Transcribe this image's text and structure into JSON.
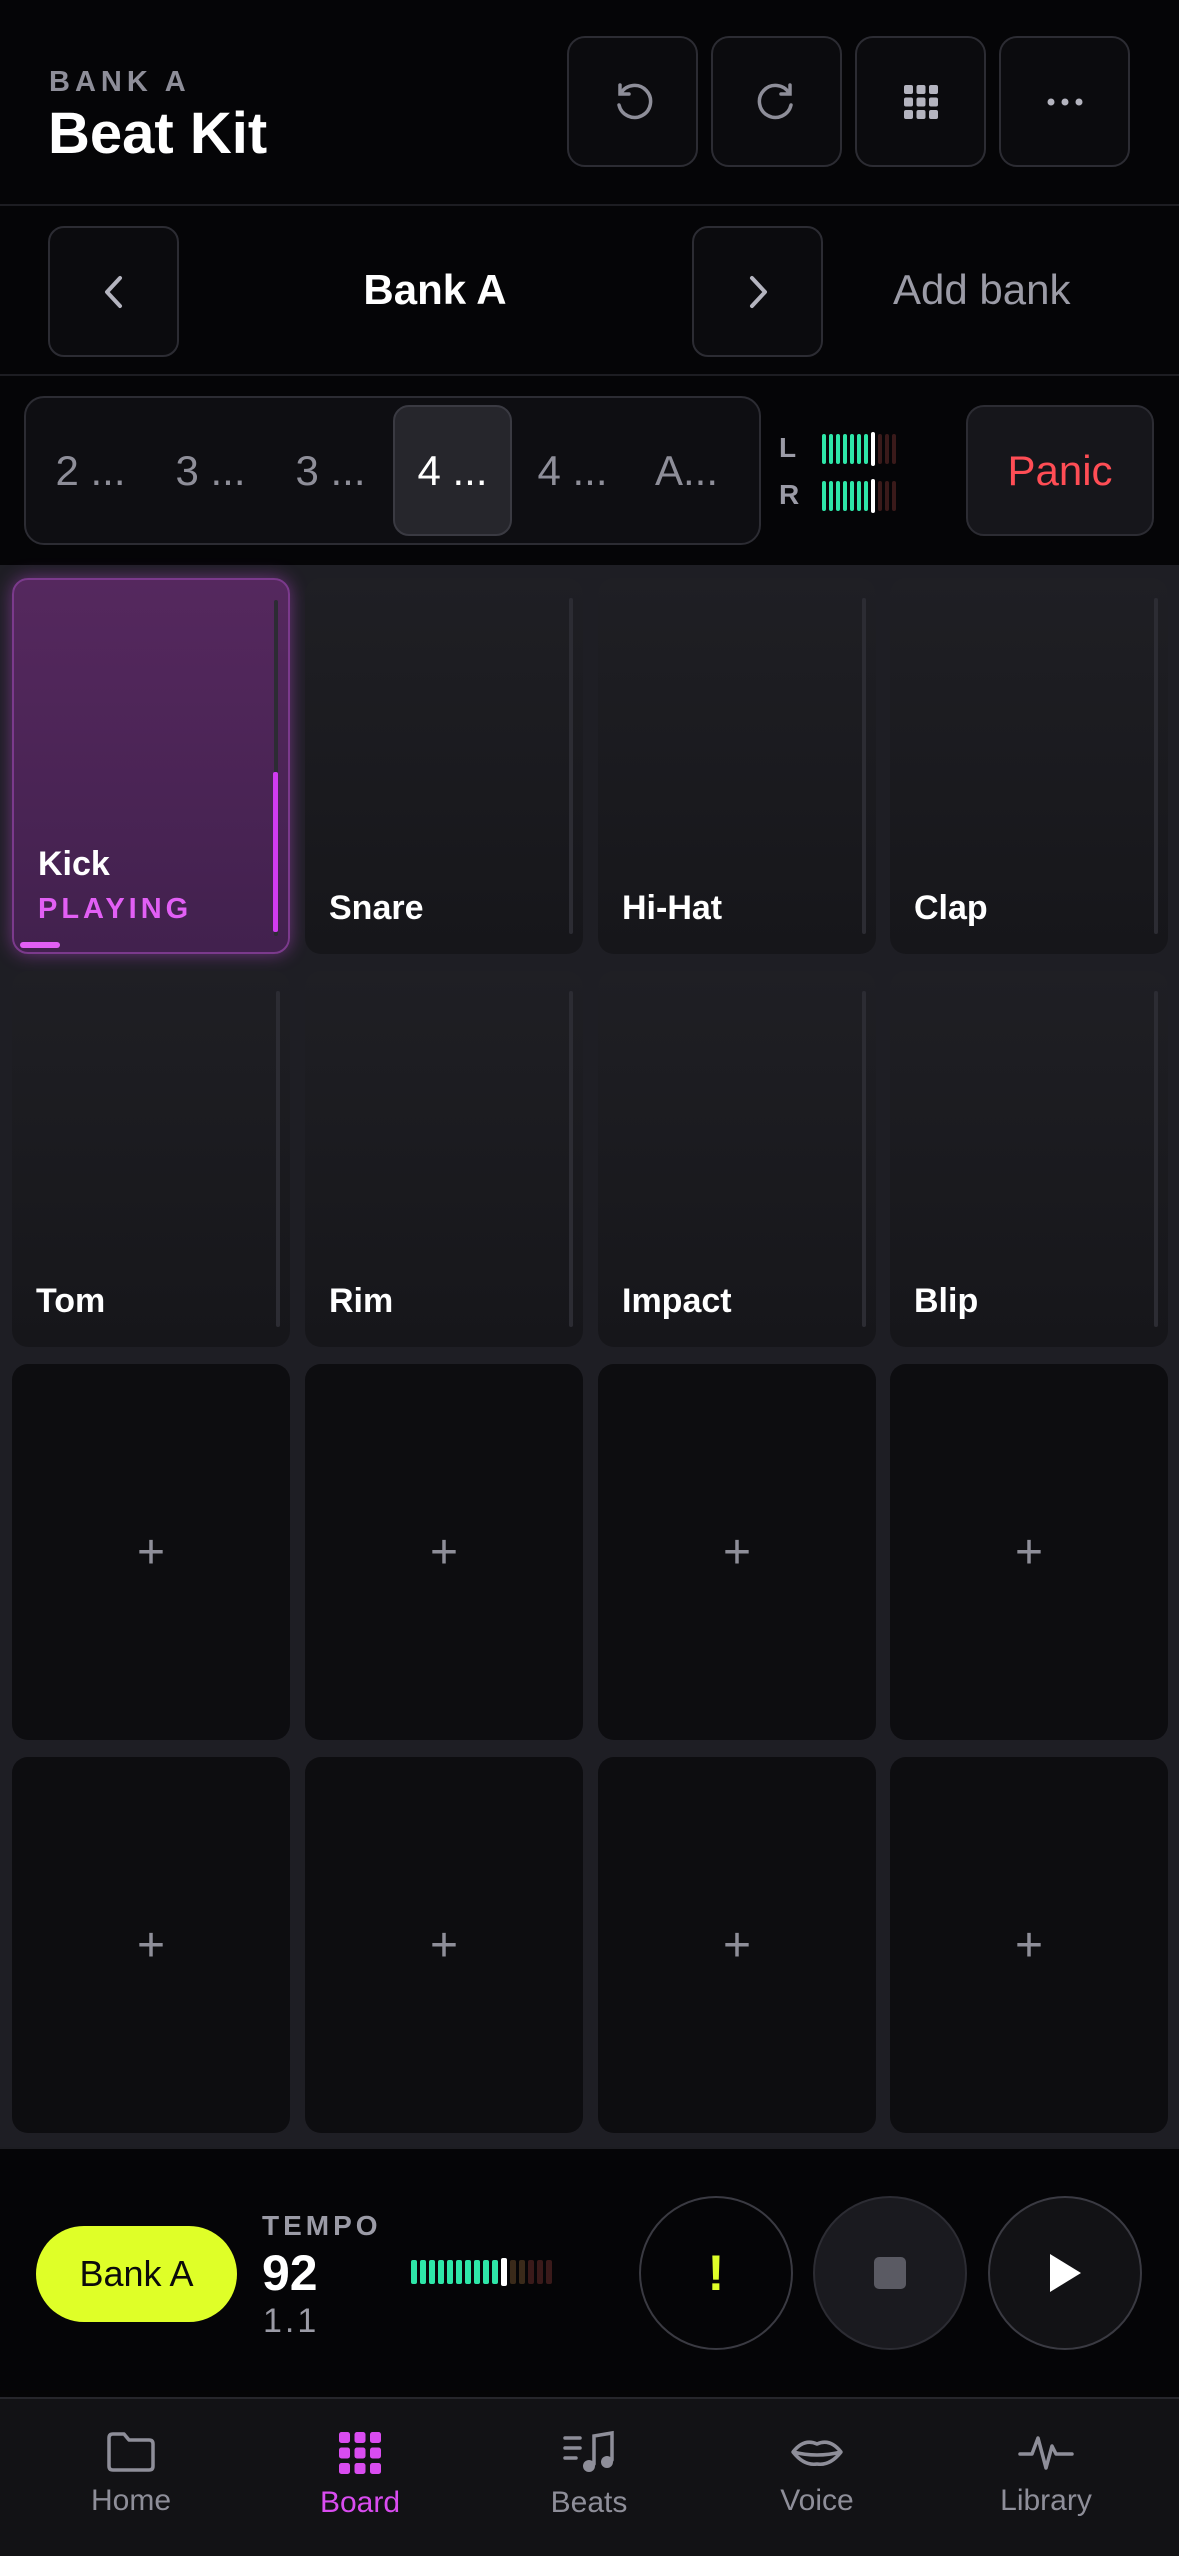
{
  "header": {
    "bank_label": "BANK A",
    "title": "Beat Kit",
    "buttons": [
      {
        "name": "undo",
        "icon": "undo-icon"
      },
      {
        "name": "redo",
        "icon": "redo-icon"
      },
      {
        "name": "grid",
        "icon": "grid-icon"
      },
      {
        "name": "more",
        "icon": "more-icon"
      }
    ]
  },
  "bank_switcher": {
    "current": "Bank A",
    "add_label": "Add bank"
  },
  "patterns": {
    "tabs": [
      "2 ...",
      "3 ...",
      "3 ...",
      "4 ...",
      "4 ...",
      "A..."
    ],
    "active_index": 3
  },
  "meters": {
    "left_label": "L",
    "right_label": "R",
    "colors": {
      "on": "#2ee6a8",
      "peak": "#ffffff",
      "off": "#3a2a1a"
    }
  },
  "panic_label": "Panic",
  "pads": [
    {
      "label": "Kick",
      "status": "PLAYING",
      "state": "playing",
      "level": 0.3,
      "progress": 0.1
    },
    {
      "label": "Snare",
      "state": "idle"
    },
    {
      "label": "Hi-Hat",
      "state": "idle"
    },
    {
      "label": "Clap",
      "state": "idle"
    },
    {
      "label": "Tom",
      "state": "idle"
    },
    {
      "label": "Rim",
      "state": "idle"
    },
    {
      "label": "Impact",
      "state": "idle"
    },
    {
      "label": "Blip",
      "state": "idle"
    },
    {
      "label": "+",
      "state": "empty"
    },
    {
      "label": "+",
      "state": "empty"
    },
    {
      "label": "+",
      "state": "empty"
    },
    {
      "label": "+",
      "state": "empty"
    },
    {
      "label": "+",
      "state": "empty"
    },
    {
      "label": "+",
      "state": "empty"
    },
    {
      "label": "+",
      "state": "empty"
    },
    {
      "label": "+",
      "state": "empty"
    }
  ],
  "transport": {
    "bank_button": "Bank A",
    "tempo_label": "TEMPO",
    "tempo": "92",
    "position": "1.1",
    "alert_symbol": "!",
    "colors": {
      "accent": "#dfff28",
      "alert": "#dfff28"
    }
  },
  "bottom_nav": {
    "items": [
      {
        "label": "Home",
        "icon": "folder-icon"
      },
      {
        "label": "Board",
        "icon": "grid-icon"
      },
      {
        "label": "Beats",
        "icon": "music-list-icon"
      },
      {
        "label": "Voice",
        "icon": "lips-icon"
      },
      {
        "label": "Library",
        "icon": "waveform-icon"
      }
    ],
    "active_index": 1
  }
}
